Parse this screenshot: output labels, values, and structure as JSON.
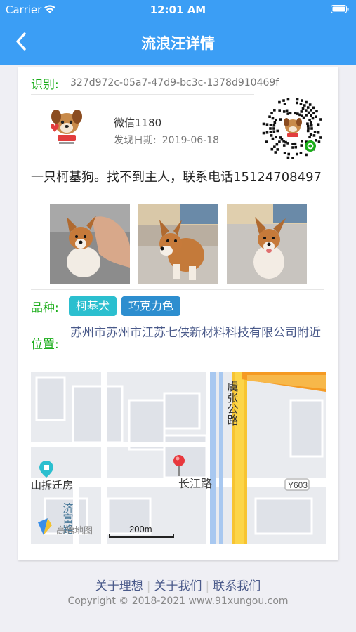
{
  "status_bar": {
    "carrier": "Carrier",
    "time": "12:01 AM"
  },
  "nav": {
    "title": "流浪汪详情",
    "back_icon": "chevron-left-icon"
  },
  "detail": {
    "id_label": "识别:",
    "id_value": "327d972c-05a7-47d9-bc3c-1378d910469f",
    "user_name": "微信1180",
    "found_date_label": "发现日期:",
    "found_date": "2019-06-18",
    "description": "一只柯基狗。找不到主人，联系电话15124708497",
    "breed_label": "品种:",
    "breeds": [
      "柯基犬",
      "巧克力色"
    ],
    "location_label": "位置:",
    "location": "苏州市苏州市江苏七侠新材料科技有限公司附近"
  },
  "map": {
    "road_vertical": "虞张公路",
    "road_horizontal": "长江路",
    "road_code": "Y603",
    "poi_name": "山拆迁房",
    "road_small": "济富路",
    "scale": "200m",
    "brand": "高德地图"
  },
  "footer": {
    "links": [
      "关于理想",
      "关于我们",
      "联系我们"
    ],
    "copyright": "Copyright © 2018-2021 www.91xungou.com"
  },
  "colors": {
    "nav": "#3b9ef5",
    "green_label": "#1aad19",
    "tag_corgi": "#2bbfcf",
    "tag_color": "#2d8ecf"
  }
}
